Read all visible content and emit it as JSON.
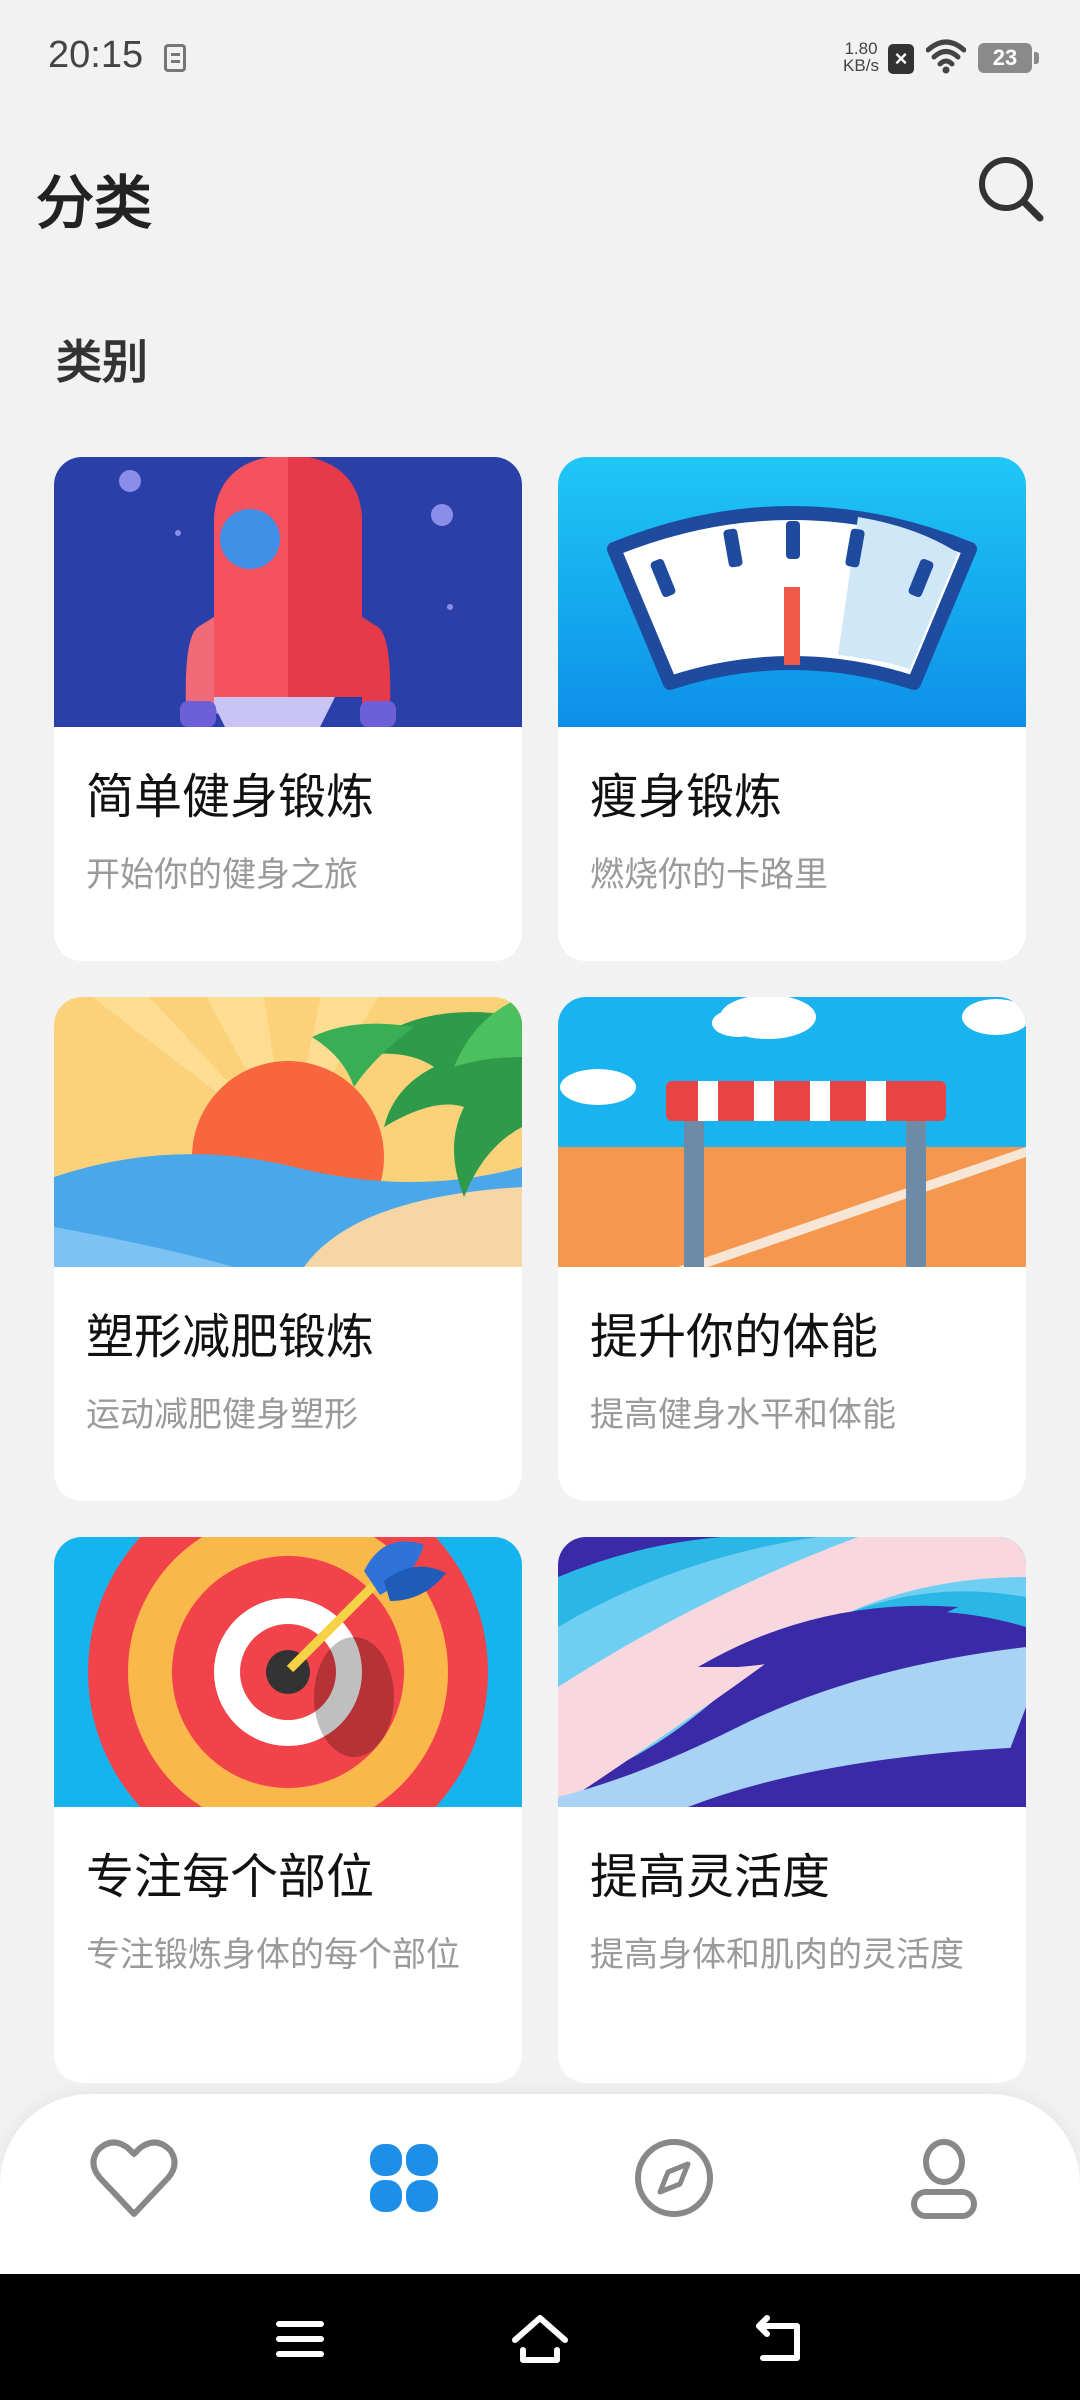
{
  "status_bar": {
    "time": "20:15",
    "net_speed_value": "1.80",
    "net_speed_unit": "KB/s",
    "battery": "23"
  },
  "header": {
    "title": "分类"
  },
  "section": {
    "title": "类别"
  },
  "cards": [
    {
      "title": "简单健身锻炼",
      "subtitle": "开始你的健身之旅",
      "image": "rocket"
    },
    {
      "title": "瘦身锻炼",
      "subtitle": "燃烧你的卡路里",
      "image": "scale"
    },
    {
      "title": "塑形减肥锻炼",
      "subtitle": "运动减肥健身塑形",
      "image": "beach-sunset"
    },
    {
      "title": "提升你的体能",
      "subtitle": "提高健身水平和体能",
      "image": "hurdle"
    },
    {
      "title": "专注每个部位",
      "subtitle": "专注锻炼身体的每个部位",
      "image": "target-dart"
    },
    {
      "title": "提高灵活度",
      "subtitle": "提高身体和肌肉的灵活度",
      "image": "waves"
    }
  ],
  "bottom_nav": {
    "items": [
      "heart-icon",
      "grid-icon",
      "compass-icon",
      "person-icon"
    ],
    "active_index": 1,
    "active_color": "#1e8fe8",
    "inactive_color": "#888888"
  },
  "system_nav": [
    "menu-icon",
    "home-icon",
    "back-icon"
  ]
}
